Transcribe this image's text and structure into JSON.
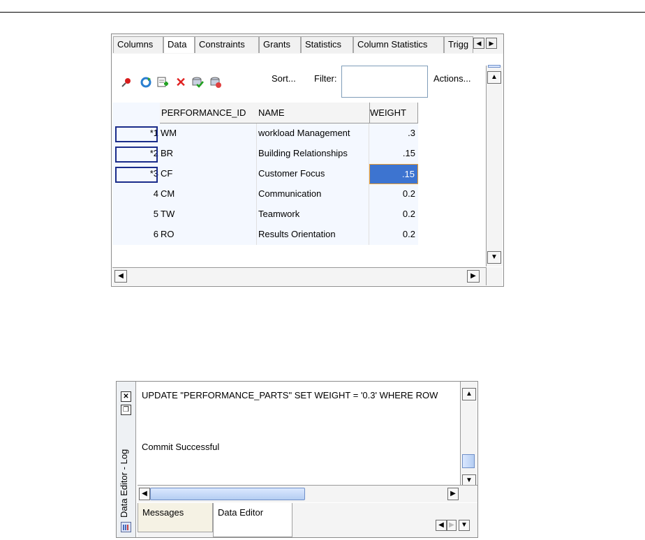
{
  "panel1": {
    "tabs": [
      "Columns",
      "Data",
      "Constraints",
      "Grants",
      "Statistics",
      "Column Statistics",
      "Trigg"
    ],
    "active_tab": "Data",
    "toolbar": {
      "icons": [
        "pin-icon",
        "refresh-icon",
        "insert-row-icon",
        "delete-row-icon",
        "commit-icon",
        "rollback-icon"
      ],
      "sort_label": "Sort...",
      "filter_label": "Filter:",
      "filter_value": "",
      "actions_label": "Actions..."
    },
    "table": {
      "headers": [
        "PERFORMANCE_ID",
        "NAME",
        "WEIGHT"
      ],
      "rows": [
        {
          "num": "*1",
          "id": "WM",
          "name": "workload Management",
          "weight": ".3"
        },
        {
          "num": "*2",
          "id": "BR",
          "name": "Building Relationships",
          "weight": ".15"
        },
        {
          "num": "*3",
          "id": "CF",
          "name": "Customer Focus",
          "weight": ".15"
        },
        {
          "num": "4",
          "id": "CM",
          "name": "Communication",
          "weight": "0.2"
        },
        {
          "num": "5",
          "id": "TW",
          "name": "Teamwork",
          "weight": "0.2"
        },
        {
          "num": "6",
          "id": "RO",
          "name": "Results Orientation",
          "weight": "0.2"
        }
      ]
    },
    "selected_cell": {
      "row": 2,
      "column": "WEIGHT"
    }
  },
  "panel2": {
    "title": "Data Editor - Log",
    "log_lines": [
      "UPDATE \"PERFORMANCE_PARTS\" SET WEIGHT = '0.3' WHERE ROW",
      "Commit Successful"
    ],
    "bottom_tabs": [
      "Messages",
      "Data Editor"
    ],
    "active_bottom_tab": "Data Editor"
  },
  "colors": {
    "selection": "#3d74d0",
    "selection_border": "#f0a030",
    "row_marker": "#1a2c8a",
    "delete_icon": "#e02020"
  }
}
